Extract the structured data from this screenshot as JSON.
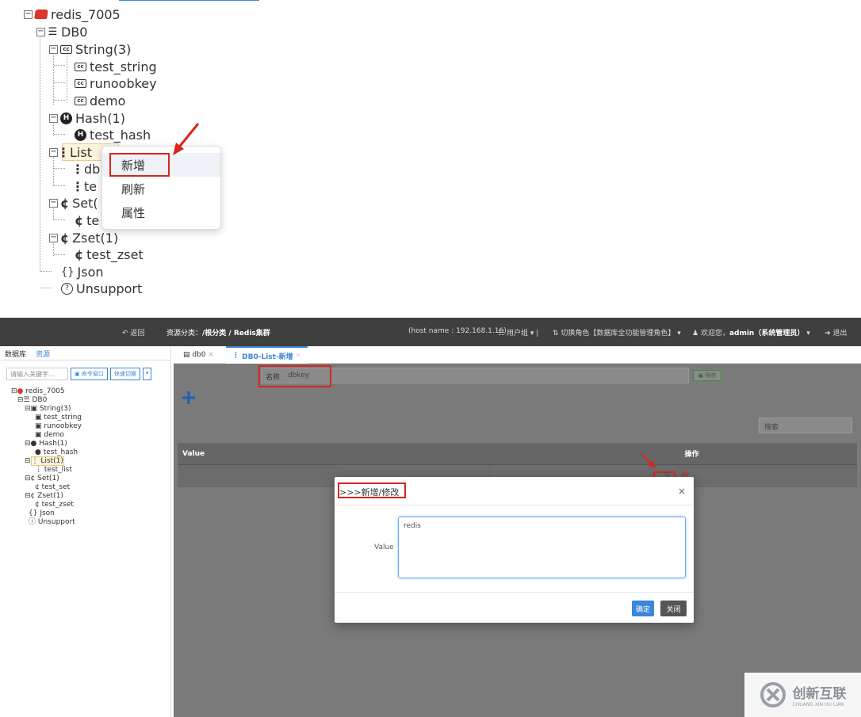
{
  "top_tree": {
    "root": "redis_7005",
    "db": "DB0",
    "string_group": "String(3)",
    "string_items": [
      "test_string",
      "runoobkey",
      "demo"
    ],
    "hash_group": "Hash(1)",
    "hash_items": [
      "test_hash"
    ],
    "list_group": "List",
    "list_items_partial": [
      "db",
      "te"
    ],
    "set_group": "Set(",
    "set_items_partial": [
      "te"
    ],
    "zset_group": "Zset(1)",
    "zset_items": [
      "test_zset"
    ],
    "json": "Json",
    "unsupport": "Unsupport"
  },
  "context_menu": {
    "items": [
      "新增",
      "刷新",
      "属性"
    ],
    "highlighted": "新增"
  },
  "topbar": {
    "back": "返回",
    "breadcrumb_prefix": "资源分类：",
    "breadcrumb_path": "/根分类 / Redis集群",
    "host": "(host name : 192.168.1.16)",
    "user_group": "用户组",
    "switch_role": "切换角色【数据库全功能管理角色】",
    "welcome": "欢迎您，",
    "user": "admin（系统管理员）",
    "logout": "退出"
  },
  "sidebar": {
    "tabs": [
      "数据库",
      "资源"
    ],
    "search_placeholder": "请输入关键字...",
    "cmd_btn": "命令窗口",
    "filter_btn": "快速切换",
    "tree": [
      "redis_7005",
      "DB0",
      "String(3)",
      "test_string",
      "runoobkey",
      "demo",
      "Hash(1)",
      "test_hash",
      "List(1)",
      "test_list",
      "Set(1)",
      "test_set",
      "Zset(1)",
      "test_zset",
      "Json",
      "Unsupport"
    ]
  },
  "tabs": [
    {
      "label": "db0"
    },
    {
      "label": "DB0-List-新增"
    }
  ],
  "form": {
    "name_label": "名称",
    "name_value": "dbkey",
    "save_label": "保存",
    "search_placeholder": "搜索"
  },
  "table": {
    "headers": [
      "Value",
      "操作"
    ]
  },
  "modal": {
    "title": ">>>新增/修改",
    "close": "×",
    "field_label": "Value",
    "field_value": "redis",
    "confirm": "确定",
    "cancel": "关闭"
  },
  "watermark": {
    "cn": "创新互联",
    "en": "CHUANG XIN HU LIAN"
  },
  "colors": {
    "accent": "#3a86d8",
    "highlight": "#d9251d",
    "topbar": "#3f3f3f",
    "redis": "#d9372a"
  }
}
